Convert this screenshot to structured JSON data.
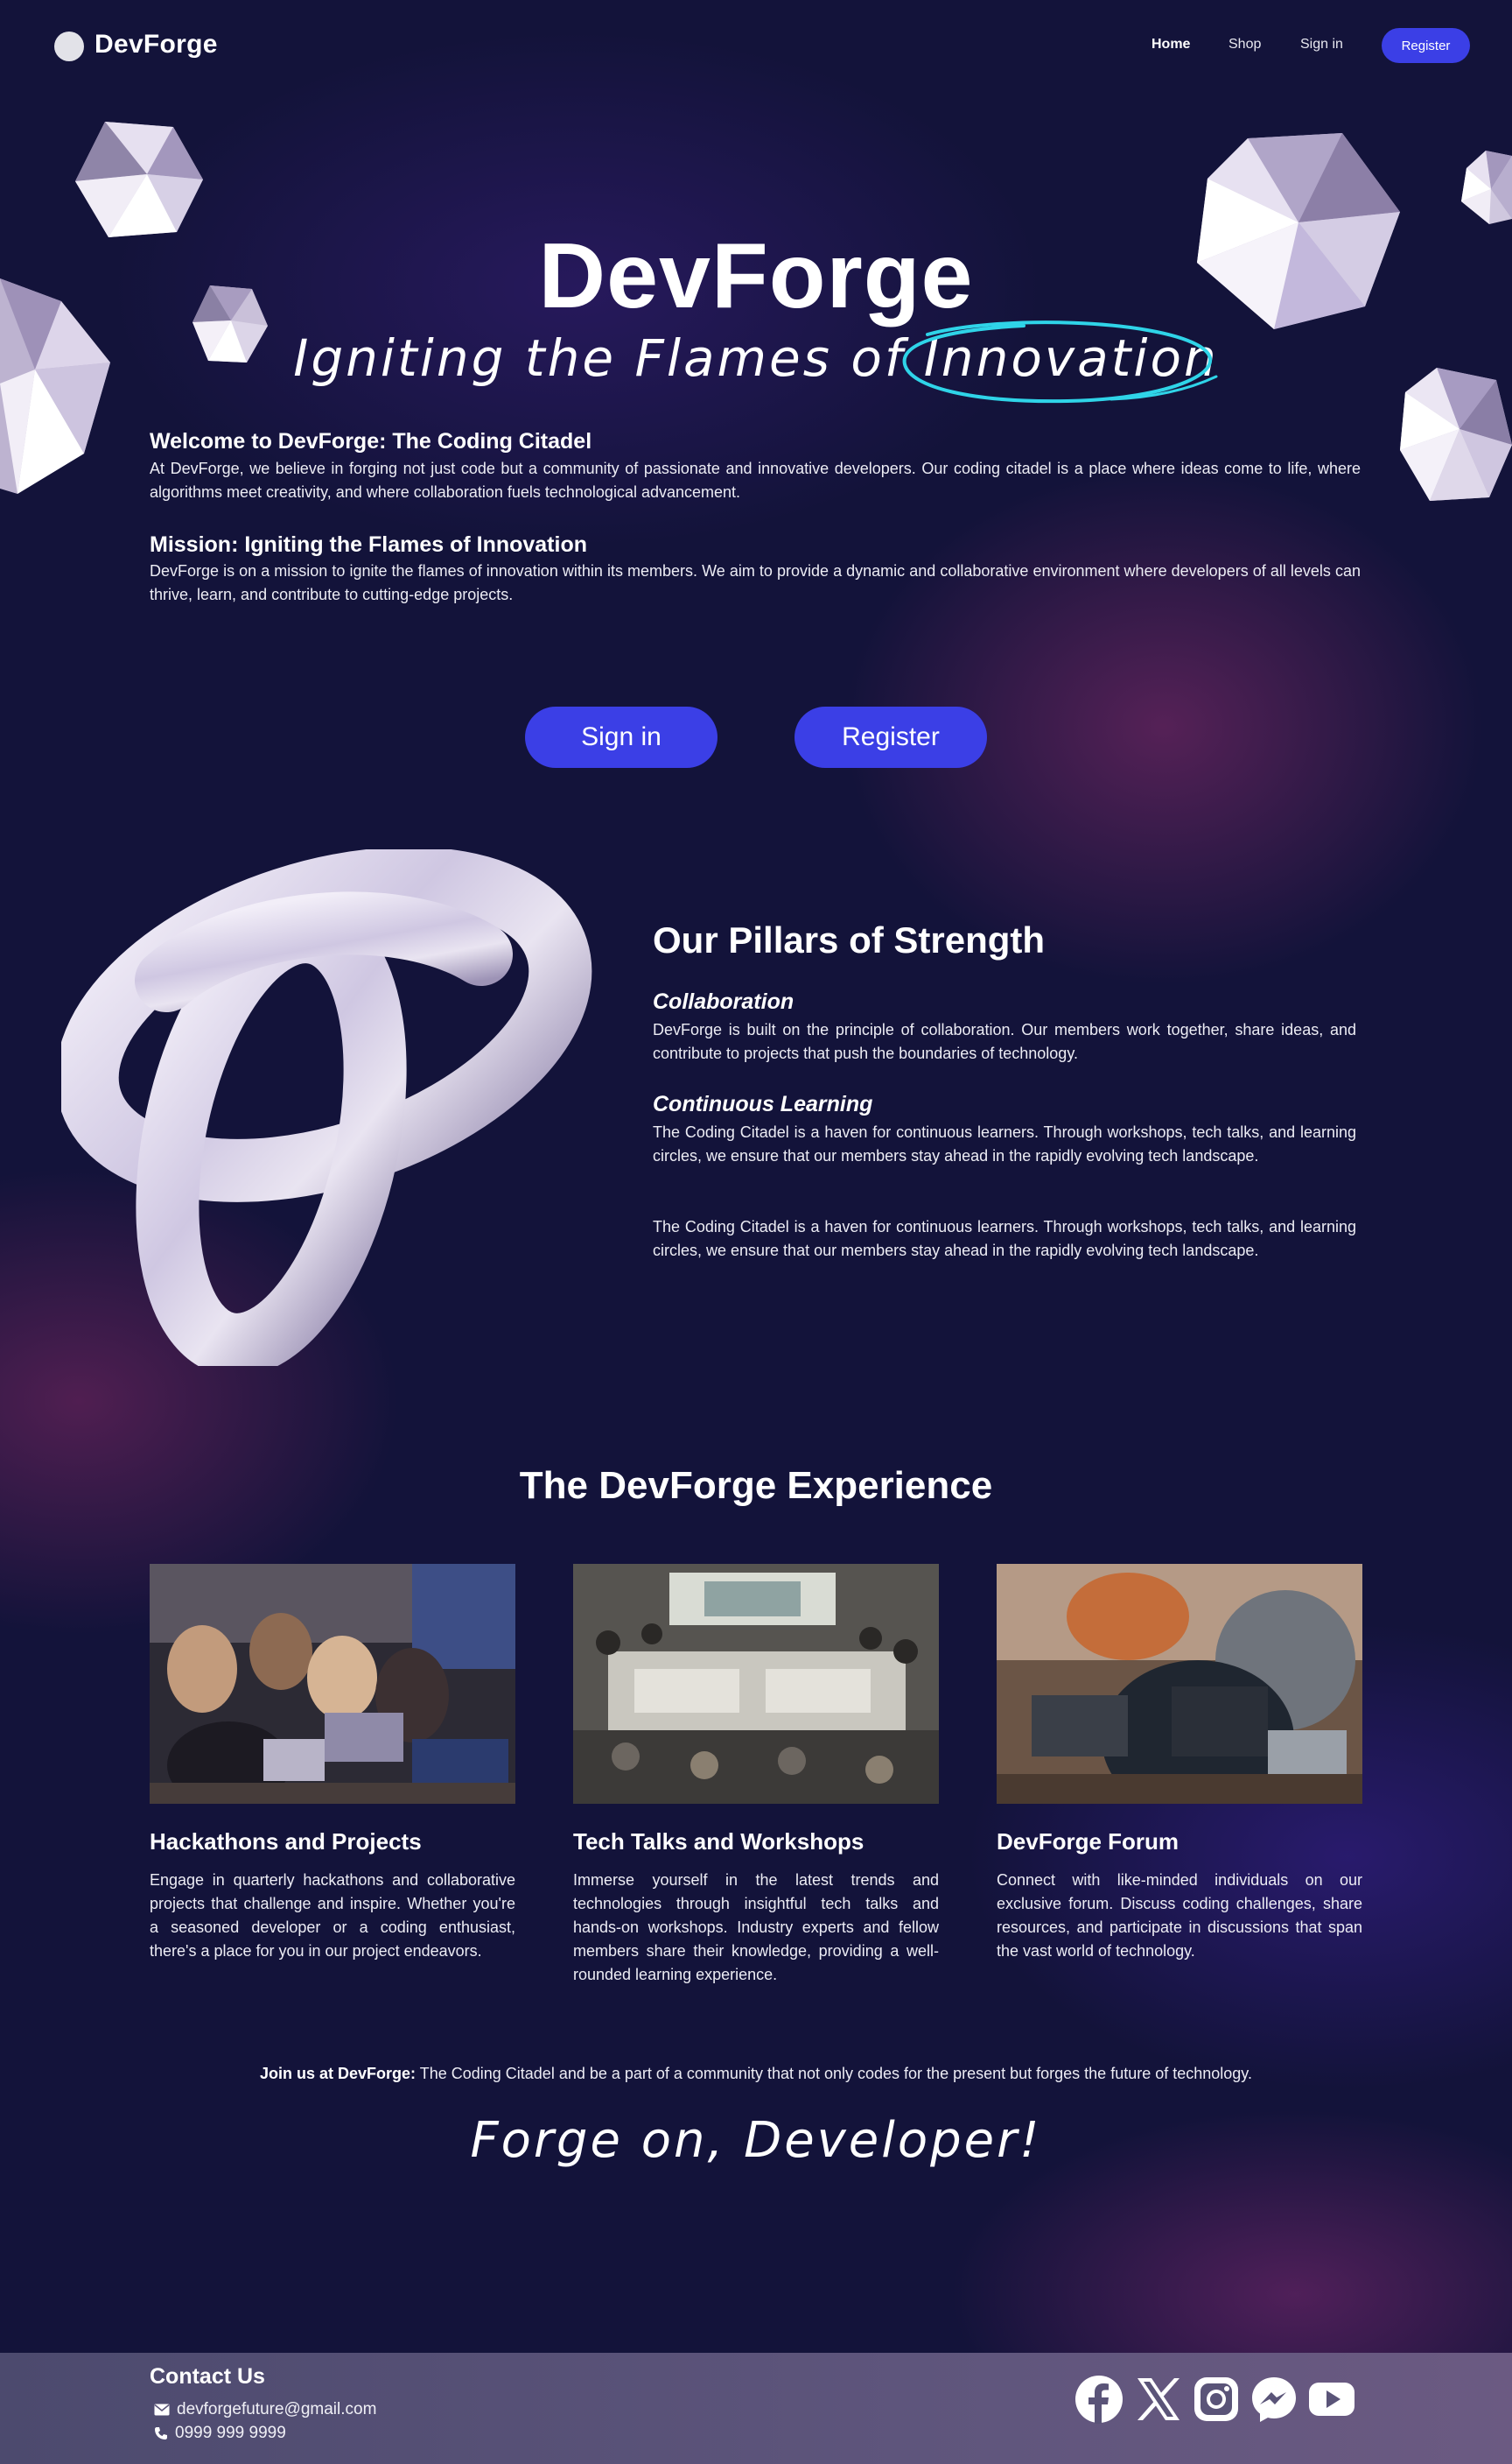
{
  "nav": {
    "brand": "DevForge",
    "links": [
      "Home",
      "Shop",
      "Sign in"
    ],
    "register": "Register"
  },
  "hero": {
    "title": "DevForge",
    "subtitle": "Igniting the Flames of Innovation"
  },
  "welcome": {
    "heading": "Welcome to DevForge: The Coding Citadel",
    "text": "At DevForge, we believe in forging not just code but a community of passionate and innovative developers. Our coding citadel is a place where ideas come to life, where algorithms meet creativity, and where collaboration fuels technological advancement."
  },
  "mission": {
    "heading": "Mission: Igniting the Flames of Innovation",
    "text": "DevForge is on a mission to ignite the flames of innovation within its members. We aim to provide a dynamic and collaborative environment where developers of all levels can thrive, learn, and contribute to cutting-edge projects."
  },
  "cta": {
    "signin": "Sign in",
    "register": "Register"
  },
  "pillars": {
    "title": "Our Pillars of Strength",
    "items": [
      {
        "heading": "Collaboration",
        "text": "DevForge is built on the principle of collaboration. Our members work together, share ideas, and contribute to projects that push the boundaries of technology."
      },
      {
        "heading": "Continuous Learning",
        "text": "The Coding Citadel is a haven for continuous learners. Through workshops, tech talks, and learning circles, we ensure that our members stay ahead in the rapidly evolving tech landscape.",
        "text2": "The Coding Citadel is a haven for continuous learners. Through workshops, tech talks, and learning circles, we ensure that our members stay ahead in the rapidly evolving tech landscape."
      }
    ]
  },
  "experience": {
    "title": "The DevForge Experience",
    "cards": [
      {
        "heading": "Hackathons and Projects",
        "text": "Engage in quarterly hackathons and collaborative projects that challenge and inspire. Whether you're a seasoned developer or a coding enthusiast, there's a place for you in our project endeavors."
      },
      {
        "heading": "Tech Talks and Workshops",
        "text": "Immerse yourself in the latest trends and technologies through insightful tech talks and hands-on workshops. Industry experts and fellow members share their knowledge, providing a well-rounded learning experience."
      },
      {
        "heading": "DevForge Forum",
        "text": "Connect with like-minded individuals on our exclusive forum. Discuss coding challenges, share resources, and participate in discussions that span the vast world of technology."
      }
    ]
  },
  "join": {
    "bold": "Join us at DevForge:",
    "text": " The Coding Citadel and be a part of a community that not only codes for the present but forges the future of technology."
  },
  "closing": "Forge on, Developer!",
  "footer": {
    "heading": "Contact Us",
    "email": "devforgefuture@gmail.com",
    "phone": "0999 999 9999",
    "social": [
      "facebook-icon",
      "x-icon",
      "instagram-icon",
      "messenger-icon",
      "youtube-icon"
    ]
  },
  "colors": {
    "background": "#13133a",
    "accent": "#3b3fe6",
    "highlight": "#2fd4e8"
  }
}
